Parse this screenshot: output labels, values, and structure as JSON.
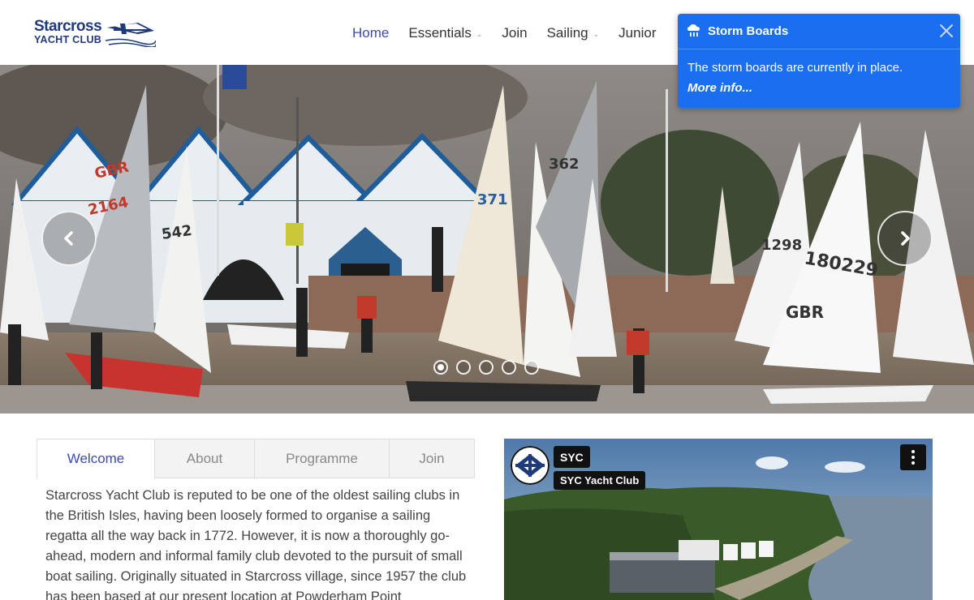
{
  "logo": {
    "line1": "Starcross",
    "line2": "YACHT CLUB"
  },
  "nav": {
    "items": [
      {
        "label": "Home",
        "active": true,
        "dropdown": false
      },
      {
        "label": "Essentials",
        "active": false,
        "dropdown": true
      },
      {
        "label": "Join",
        "active": false,
        "dropdown": false
      },
      {
        "label": "Sailing",
        "active": false,
        "dropdown": true
      },
      {
        "label": "Junior",
        "active": false,
        "dropdown": false
      }
    ]
  },
  "notice": {
    "title": "Storm Boards",
    "body": "The storm boards are currently in place.",
    "link": "More info...",
    "icon": "storm-cloud-icon",
    "color": "#1a6ef0"
  },
  "carousel": {
    "slides": 5,
    "current": 1
  },
  "tabs": [
    {
      "label": "Welcome",
      "active": true
    },
    {
      "label": "About",
      "active": false
    },
    {
      "label": "Programme",
      "active": false
    },
    {
      "label": "Join",
      "active": false
    }
  ],
  "welcome_text": "Starcross Yacht Club is reputed to be one of the oldest sailing clubs in the British Isles, having been loosely formed to organise a sailing regatta all the way back in 1772. However, it is now a thoroughly go-ahead, modern and informal family club devoted to the pursuit of small boat sailing. Originally situated in Starcross village, since 1957 the club has been based at our present location at Powderham Point",
  "video": {
    "channel_short": "SYC",
    "channel_name": "SYC Yacht Club"
  },
  "sail_labels": [
    "GBR",
    "2164",
    "542",
    "371",
    "362",
    "180229",
    "1298",
    "GBR"
  ],
  "colors": {
    "accent": "#3e4bab",
    "brand": "#1f3a7a"
  }
}
